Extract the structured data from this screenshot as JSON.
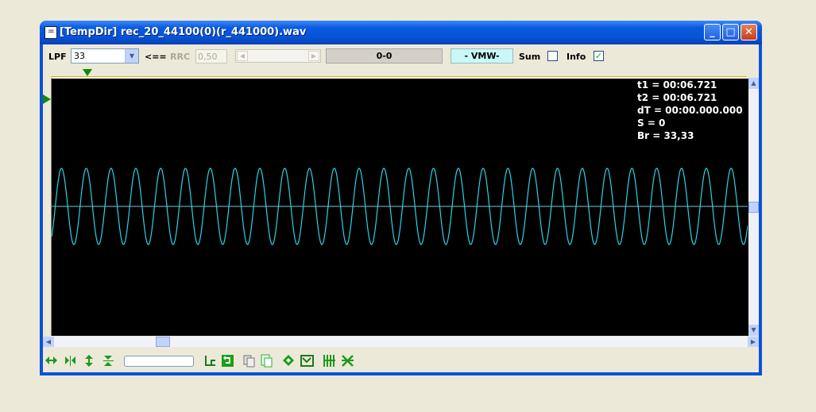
{
  "window": {
    "title": "[TempDir] rec_20_44100(0)(r_441000).wav"
  },
  "toolbar": {
    "lpf_label": "LPF",
    "lpf_value": "33",
    "arrow_label": "<==",
    "rrc_label": "RRC",
    "rrc_value": "0,50",
    "status": "0-0",
    "vmw": "- VMW-",
    "sum_label": "Sum",
    "sum_checked": false,
    "info_label": "Info",
    "info_checked": true
  },
  "info": {
    "t1": "t1 = 00:06.721",
    "t2": "t2 = 00:06.721",
    "dt": "dT = 00:00.000.000",
    "s": "S = 0",
    "br": "Br = 33,33"
  },
  "waveform": {
    "color": "#2ad4e6",
    "baseline_color": "#7ec8d0",
    "cycles": 28
  },
  "colors": {
    "plot_bg": "#000000",
    "marker": "#0d8a0d",
    "accent": "#0a52d8"
  }
}
